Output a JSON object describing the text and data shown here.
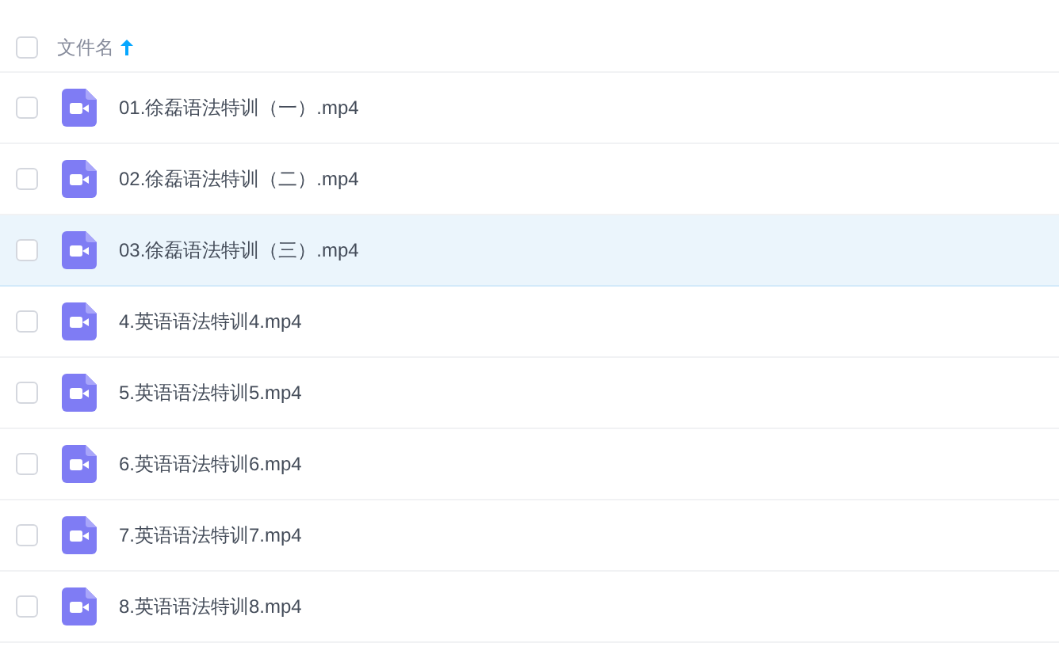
{
  "table": {
    "header": {
      "label": "文件名",
      "sorted_ascending": true,
      "checked": false
    },
    "rows": [
      {
        "name": "01.徐磊语法特训（一）.mp4",
        "selected": false,
        "checked": false
      },
      {
        "name": "02.徐磊语法特训（二）.mp4",
        "selected": false,
        "checked": false
      },
      {
        "name": "03.徐磊语法特训（三）.mp4",
        "selected": true,
        "checked": false
      },
      {
        "name": "4.英语语法特训4.mp4",
        "selected": false,
        "checked": false
      },
      {
        "name": "5.英语语法特训5.mp4",
        "selected": false,
        "checked": false
      },
      {
        "name": "6.英语语法特训6.mp4",
        "selected": false,
        "checked": false
      },
      {
        "name": "7.英语语法特训7.mp4",
        "selected": false,
        "checked": false
      },
      {
        "name": "8.英语语法特训8.mp4",
        "selected": false,
        "checked": false
      }
    ]
  }
}
